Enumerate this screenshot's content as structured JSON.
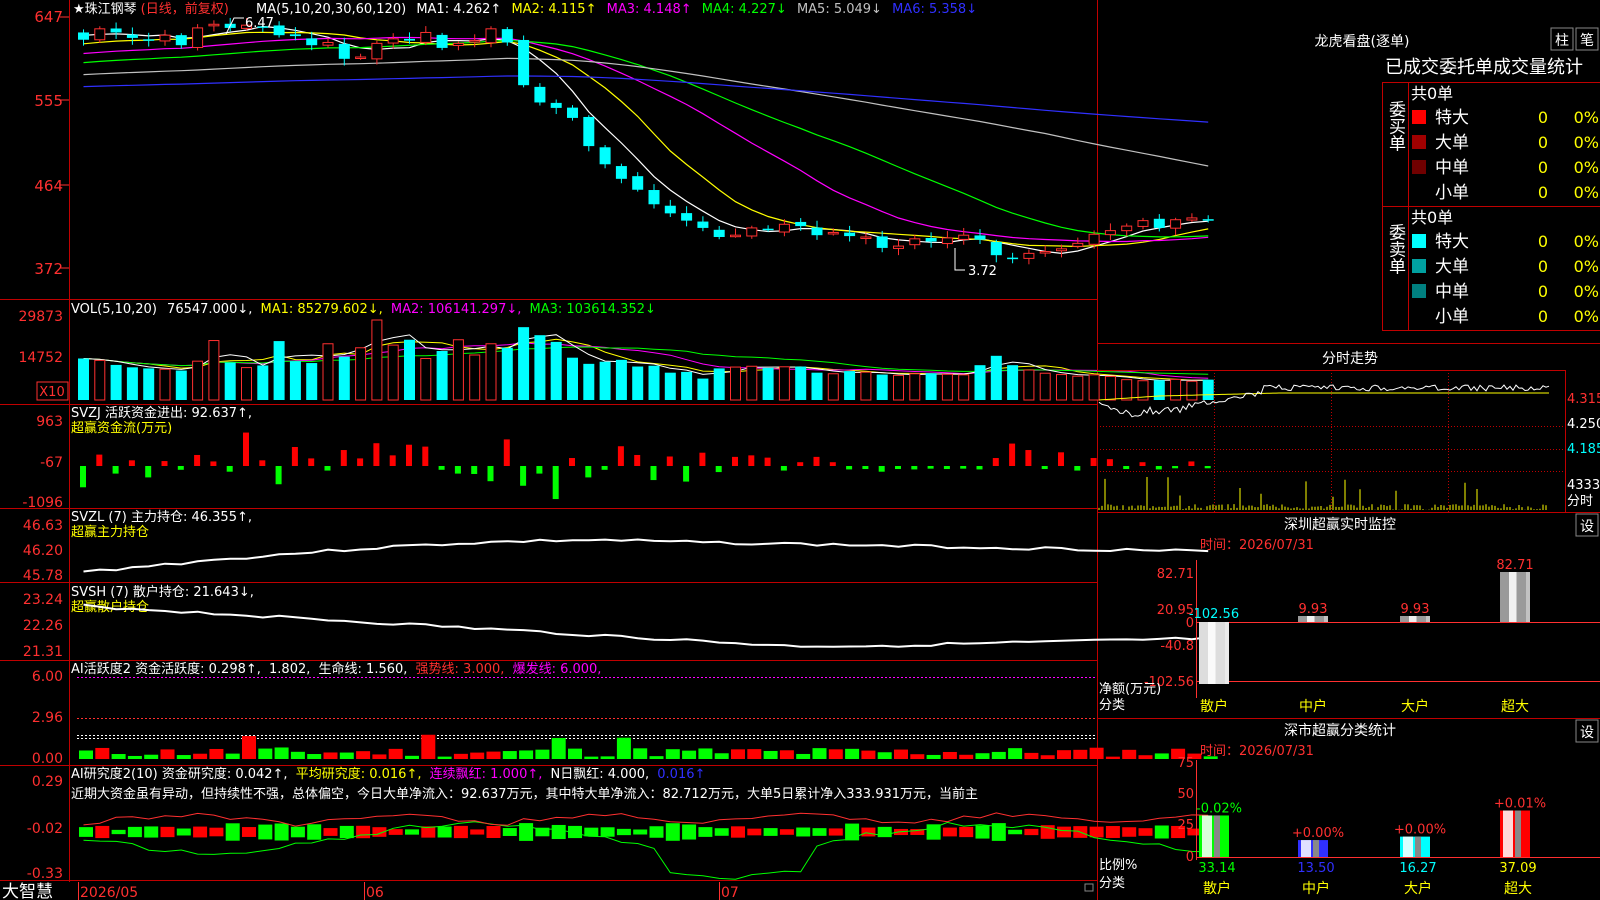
{
  "title": {
    "stock": "★珠江钢琴",
    "mode": "(日线，前复权)"
  },
  "price": {
    "ma_header": [
      {
        "text": "MA(5,10,20,30,60,120)",
        "color": "#ffffff"
      },
      {
        "text": "MA1: 4.262↑",
        "color": "#ffffff"
      },
      {
        "text": "MA2: 4.115↑",
        "color": "#ffff00"
      },
      {
        "text": "MA3: 4.148↑",
        "color": "#ff00ff"
      },
      {
        "text": "MA4: 4.227↓",
        "color": "#00ff00"
      },
      {
        "text": "MA5: 5.049↓",
        "color": "#c0c0c0"
      },
      {
        "text": "MA6: 5.358↓",
        "color": "#3030ff"
      }
    ],
    "y_ticks": [
      "647",
      "555",
      "464",
      "372"
    ],
    "high_label": "6.47",
    "low_label": "3.72"
  },
  "volume": {
    "header": [
      {
        "text": "VOL(5,10,20)",
        "color": "#ffffff"
      },
      {
        "text": "76547.000↓,",
        "color": "#ffffff"
      },
      {
        "text": "MA1: 85279.602↓,",
        "color": "#ffff00"
      },
      {
        "text": "MA2: 106141.297↓,",
        "color": "#ff00ff"
      },
      {
        "text": "MA3: 103614.352↓",
        "color": "#00ff00"
      }
    ],
    "y_ticks": [
      "29873",
      "14752"
    ],
    "unit": "X10"
  },
  "svzj": {
    "line1": "SVZJ  活跃资金进出: 92.637↑,",
    "line2": "超赢资金流(万元)",
    "y_ticks": [
      "963",
      "-67",
      "-1096"
    ]
  },
  "svzl": {
    "line1": "SVZL (7) 主力持仓: 46.355↑,",
    "line2": "超赢主力持仓",
    "y_ticks": [
      "46.63",
      "46.20",
      "45.78"
    ]
  },
  "svsh": {
    "line1": "SVSH (7) 散户持仓: 21.643↓,",
    "line2": "超赢散户持仓",
    "y_ticks": [
      "23.24",
      "22.26",
      "21.31"
    ]
  },
  "ai_active": {
    "header": [
      {
        "text": "AI活跃度2 资金活跃度: 0.298↑,",
        "color": "#ffffff"
      },
      {
        "text": "1.802,",
        "color": "#ffffff"
      },
      {
        "text": "生命线: 1.560,",
        "color": "#ffffff"
      },
      {
        "text": "强势线: 3.000,",
        "color": "#ff3030"
      },
      {
        "text": "爆发线: 6.000,",
        "color": "#ff00ff"
      }
    ],
    "y_ticks": [
      "6.00",
      "2.96",
      "0.00"
    ]
  },
  "ai_research": {
    "header": [
      {
        "text": "AI研究度2(10) 资金研究度: 0.042↑,",
        "color": "#ffffff"
      },
      {
        "text": "平均研究度: 0.016↑,",
        "color": "#ffff00"
      },
      {
        "text": "连续飘红: 1.000↑,",
        "color": "#ff00ff"
      },
      {
        "text": "N日飘红: 4.000,",
        "color": "#ffffff"
      },
      {
        "text": "0.016↑",
        "color": "#3030ff"
      }
    ],
    "commentary": "近期大资金虽有异动，但持续性不强，总体偏空，今日大单净流入：92.637万元，其中特大单净流入：82.712万元，大单5日累计净入333.931万元，当前主",
    "y_ticks": [
      "0.29",
      "-0.02",
      "-0.33"
    ]
  },
  "x_axis": {
    "labels": [
      "2026/05",
      "06",
      "07"
    ]
  },
  "brand": "大智慧",
  "dragon": {
    "title": "龙虎看盘(逐单)",
    "btn_zhu": "柱",
    "btn_bi": "笔",
    "subtitle": "已成交委托单成交量统计",
    "buy": {
      "vert": "委买单",
      "total": "共0单",
      "rows": [
        {
          "label": "特大",
          "count": "0",
          "pct": "0%",
          "color": "#ff0000"
        },
        {
          "label": "大单",
          "count": "0",
          "pct": "0%",
          "color": "#a00000"
        },
        {
          "label": "中单",
          "count": "0",
          "pct": "0%",
          "color": "#700000"
        },
        {
          "label": "小单",
          "count": "0",
          "pct": "0%",
          "color": ""
        }
      ]
    },
    "sell": {
      "vert": "委卖单",
      "total": "共0单",
      "rows": [
        {
          "label": "特大",
          "count": "0",
          "pct": "0%",
          "color": "#00ffff"
        },
        {
          "label": "大单",
          "count": "0",
          "pct": "0%",
          "color": "#00a0a0"
        },
        {
          "label": "中单",
          "count": "0",
          "pct": "0%",
          "color": "#008080"
        },
        {
          "label": "小单",
          "count": "0",
          "pct": "0%",
          "color": ""
        }
      ]
    }
  },
  "intraday": {
    "title": "分时走势",
    "prices": [
      "4.315",
      "4.250",
      "4.185"
    ],
    "volume_max": "4333",
    "unit": "分时"
  },
  "sz_monitor": {
    "title": "深圳超赢实时监控",
    "set_btn": "设",
    "time": "时间：2026/07/31",
    "y_ticks": [
      "82.71",
      "20.95",
      "0",
      "-40.8",
      "-102.56"
    ],
    "bar_values": [
      "-102.56",
      "9.93",
      "9.93",
      "82.71"
    ],
    "categories": [
      "散户",
      "中户",
      "大户",
      "超大"
    ],
    "ylabel": "净额(万元)",
    "xlabel": "分类"
  },
  "sz_stats": {
    "title": "深市超赢分类统计",
    "set_btn": "设",
    "time": "时间：2026/07/31",
    "y_ticks": [
      "75",
      "50",
      "25",
      "0"
    ],
    "changes": [
      "-0.02%",
      "+0.00%",
      "+0.00%",
      "+0.01%"
    ],
    "values": [
      "33.14",
      "13.50",
      "16.27",
      "37.09"
    ],
    "categories": [
      "散户",
      "中户",
      "大户",
      "超大"
    ],
    "ylabel": "比例%",
    "xlabel": "分类"
  },
  "chart_data": [
    {
      "type": "candlestick",
      "title": "珠江钢琴 日线",
      "x": [
        "2026/05",
        "06",
        "07"
      ],
      "ylim": [
        3.72,
        6.47
      ],
      "series": [
        {
          "name": "K线",
          "values": [
            6.22,
            6.34,
            6.3,
            6.24,
            6.21,
            6.27,
            6.16,
            6.35,
            6.39,
            6.35,
            6.38,
            6.36,
            6.27,
            6.26,
            6.16,
            6.19,
            6.01,
            6.03,
            6.18,
            6.23,
            6.21,
            6.3,
            6.13,
            6.18,
            6.21,
            6.34,
            6.19,
            5.72,
            5.53,
            5.47,
            5.36,
            5.05,
            4.85,
            4.69,
            4.57,
            4.41,
            4.31,
            4.23,
            4.15,
            4.05,
            4.07,
            4.15,
            4.13,
            4.19,
            4.17,
            4.07,
            4.1,
            4.06,
            4.05,
            3.93,
            3.95,
            4.03,
            4.0,
            4.04,
            4.07,
            4.02,
            3.85,
            3.82,
            3.87,
            3.89,
            3.92,
            3.98,
            4.08,
            4.12,
            4.17,
            4.23,
            4.15,
            4.24,
            4.26,
            4.24
          ]
        }
      ]
    },
    {
      "type": "bar",
      "title": "VOL(5,10,20)",
      "x": [
        "2026/05",
        "06",
        "07"
      ],
      "ylim": [
        0,
        29873
      ],
      "series": [
        {
          "name": "VOL",
          "values": [
            15500,
            14800,
            13100,
            12200,
            11800,
            11500,
            11000,
            14500,
            22200,
            14000,
            12100,
            12900,
            22000,
            14500,
            13800,
            21000,
            16200,
            19500,
            29873,
            20500,
            22500,
            15500,
            18300,
            22500,
            16800,
            21000,
            19500,
            27200,
            24200,
            21700,
            15800,
            13500,
            14300,
            15000,
            12500,
            12800,
            10200,
            10500,
            8000,
            11800,
            12300,
            12600,
            12000,
            12400,
            12500,
            10200,
            9800,
            10800,
            10400,
            9500,
            9200,
            9800,
            10000,
            9600,
            9400,
            13000,
            16500,
            13000,
            11200,
            10000,
            9500,
            8900,
            9400,
            8800,
            7600,
            7200,
            7400,
            7700,
            7000,
            7600
          ]
        }
      ]
    }
  ]
}
